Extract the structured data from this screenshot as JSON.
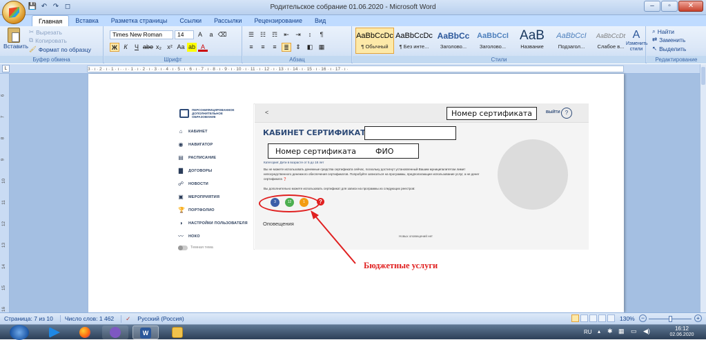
{
  "window": {
    "title": "Родительское собрание 01.06.2020 - Microsoft Word"
  },
  "qat": [
    "💾",
    "↶",
    "↷",
    "◻"
  ],
  "tabs": [
    "Главная",
    "Вставка",
    "Разметка страницы",
    "Ссылки",
    "Рассылки",
    "Рецензирование",
    "Вид"
  ],
  "ribbon": {
    "clipboard": {
      "paste": "Вставить",
      "cut": "Вырезать",
      "copy": "Копировать",
      "format": "Формат по образцу",
      "label": "Буфер обмена"
    },
    "font": {
      "name": "Times New Roman",
      "size": "14",
      "label": "Шрифт"
    },
    "paragraph": {
      "label": "Абзац"
    },
    "styles": {
      "label": "Стили",
      "items": [
        {
          "preview": "AaBbCcDc",
          "name": "¶ Обычный"
        },
        {
          "preview": "AaBbCcDc",
          "name": "¶ Без инте..."
        },
        {
          "preview": "AaBbCc",
          "name": "Заголово..."
        },
        {
          "preview": "AaBbCcI",
          "name": "Заголово..."
        },
        {
          "preview": "AaB",
          "name": "Название"
        },
        {
          "preview": "AaBbCcI",
          "name": "Подзагол..."
        },
        {
          "preview": "AaBbCcDt",
          "name": "Слабое в..."
        }
      ],
      "change": "Изменить стили"
    },
    "editing": {
      "find": "Найти",
      "replace": "Заменить",
      "select": "Выделить",
      "label": "Редактирование"
    }
  },
  "ruler": "3 · ı · 2 · ı · 1 · ı ·   · ı · 1 · ı · 2 · ı · 3 · ı · 4 · ı · 5 · ı · 6 · ı · 7 · ı · 8 · ı · 9 · ı · 10 · ı · 11 · ı · 12 · ı · 13 · ı · 14 · ı · 15 · ı · 16 · ı · 17 · ı ·",
  "vruler": [
    "6",
    "7",
    "8",
    "9",
    "10",
    "11",
    "12",
    "13",
    "14",
    "15",
    "16"
  ],
  "screenshot": {
    "logo": "ПЕРСОНИФИЦИРОВАННОЕ ДОПОЛНИТЕЛЬНОЕ ОБРАЗОВАНИЕ",
    "nav": [
      {
        "icon": "⌂",
        "label": "КАБИНЕТ"
      },
      {
        "icon": "◉",
        "label": "НАВИГАТОР"
      },
      {
        "icon": "▤",
        "label": "РАСПИСАНИЕ"
      },
      {
        "icon": "▇",
        "label": "ДОГОВОРЫ"
      },
      {
        "icon": "☍",
        "label": "НОВОСТИ"
      },
      {
        "icon": "▣",
        "label": "МЕРОПРИЯТИЯ"
      },
      {
        "icon": "🏆",
        "label": "ПОРТФОЛИО"
      },
      {
        "icon": "◑",
        "label": "НАСТРОЙКИ ПОЛЬЗОВАТЕЛЯ"
      },
      {
        "icon": "〰",
        "label": "НОКО"
      }
    ],
    "theme": "Темная тема",
    "back": "<",
    "cert_number_top": "Номер сертификата",
    "logout": "ВЫЙТИ",
    "help": "?",
    "cabinet_title": "КАБИНЕТ СЕРТИФИКАТА",
    "cert_number": "Номер сертификата",
    "fio": "ФИО",
    "category": "Категория: Дети в возрасте от 5 до 18 лет",
    "para1": "Вы не можете использовать денежные средства сертификата сейчас, поскольку достигнут установленный Вашим муниципалитетом лимит непосредственного денежного обеспечения сертификатов. Попробуйте записаться на программы, предполагающие использование услуг, а не денег сертификата",
    "para2": "Вы дополнительно можете использовать сертификат для записи на программы из следующих реестров:",
    "circles": [
      {
        "value": "3",
        "color": "#3b5ea8"
      },
      {
        "value": "12",
        "color": "#4caf50"
      },
      {
        "value": "1",
        "color": "#f39c12"
      }
    ],
    "notifications": "Оповещения",
    "no_notifications": "Новых оповещений нет"
  },
  "annotation": "Бюджетные услуги",
  "status": {
    "page": "Страница: 7 из 10",
    "words": "Число слов: 1 462",
    "lang": "Русский (Россия)",
    "zoom": "130%"
  },
  "taskbar": {
    "lang": "RU",
    "time": "16:12",
    "date": "02.06.2020"
  }
}
